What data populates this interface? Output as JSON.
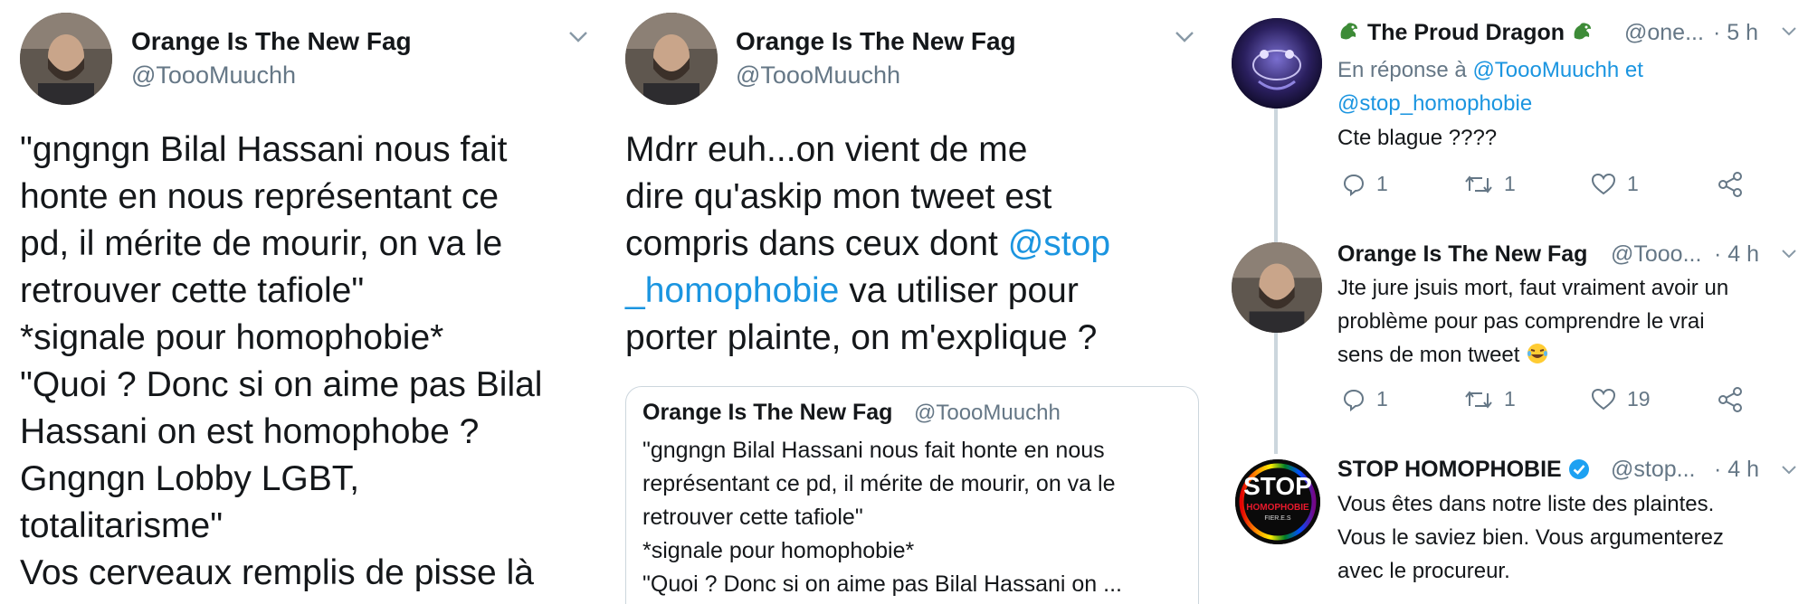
{
  "colors": {
    "link": "#1b95e0",
    "secondary": "#657786",
    "border": "#ccd6dd",
    "verified": "#1da1f2"
  },
  "panel_left": {
    "name": "Orange Is The New Fag",
    "handle": "@ToooMuuchh",
    "text_lines": [
      "\"gngngn Bilal Hassani nous fait",
      "honte en nous représentant ce",
      "pd, il mérite de mourir, on va le",
      "retrouver cette tafiole\"",
      "*signale pour homophobie*",
      "\"Quoi ? Donc si on aime pas Bilal",
      "Hassani on est homophobe ?",
      "Gngngn Lobby LGBT,",
      "totalitarisme\"",
      "Vos cerveaux remplis de pisse là"
    ]
  },
  "panel_middle": {
    "name": "Orange Is The New Fag",
    "handle": "@ToooMuuchh",
    "text": {
      "line1": "Mdrr euh...on vient de me",
      "line2": "dire qu'askip mon tweet est",
      "line3_pre": "compris dans ceux dont ",
      "line3_link": "@stop",
      "line4_link": "_homophobie",
      "line4_post": " va utiliser pour",
      "line5": "porter plainte, on m'explique ?"
    },
    "quoted": {
      "name": "Orange Is The New Fag",
      "handle": "@ToooMuuchh",
      "lines": [
        "\"gngngn Bilal Hassani nous fait honte en nous",
        "représentant ce pd, il mérite de mourir, on va le",
        "retrouver cette tafiole\"",
        "*signale pour homophobie*",
        "\"Quoi ? Donc si on aime pas Bilal Hassani on ..."
      ]
    }
  },
  "panel_right": {
    "tweets": [
      {
        "name": "The Proud Dragon",
        "name_icons": [
          "dragon-emoji",
          "dragon-emoji"
        ],
        "handle": "@one...",
        "time": "· 5 h",
        "reply_prefix": "En réponse à ",
        "reply_to_1": "@ToooMuuchh",
        "reply_and": " et",
        "reply_to_2": "@stop_homophobie",
        "lines": [
          "Cte blague ????"
        ],
        "replies": "1",
        "retweets": "1",
        "likes": "1"
      },
      {
        "name": "Orange Is The New Fag",
        "handle": "@Tooo...",
        "time": "· 4 h",
        "lines": [
          "Jte jure jsuis mort, faut vraiment avoir un",
          "problème pour pas comprendre le vrai",
          "sens de mon tweet"
        ],
        "line_emoji": "face-with-tears-of-joy",
        "replies": "1",
        "retweets": "1",
        "likes": "19"
      },
      {
        "name": "STOP HOMOPHOBIE",
        "verified": true,
        "handle": "@stop...",
        "time": "· 4 h",
        "avatar_text": {
          "big": "STOP",
          "small": "HOMOPHOBIE",
          "tiny": "FIER.E.S"
        },
        "lines": [
          "Vous êtes dans notre liste des plaintes.",
          "Vous le saviez bien. Vous argumenterez",
          "avec le procureur."
        ]
      }
    ]
  }
}
